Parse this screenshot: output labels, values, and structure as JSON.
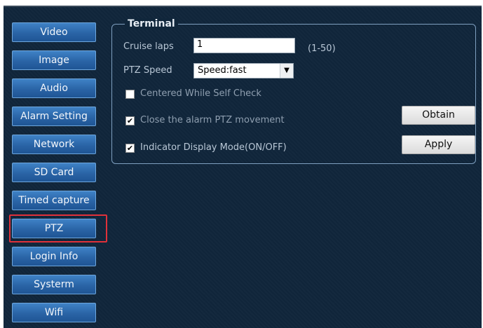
{
  "menu": {
    "items": [
      {
        "label": "Video"
      },
      {
        "label": "Image"
      },
      {
        "label": "Audio"
      },
      {
        "label": "Alarm Setting"
      },
      {
        "label": "Network"
      },
      {
        "label": "SD Card"
      },
      {
        "label": "Timed capture"
      },
      {
        "label": "PTZ"
      },
      {
        "label": "Login Info"
      },
      {
        "label": "Systerm"
      },
      {
        "label": "Wifi"
      }
    ],
    "selected": "PTZ"
  },
  "terminal": {
    "title": "Terminal",
    "cruise_laps_label": "Cruise laps",
    "cruise_laps_value": "1",
    "cruise_laps_range": "(1-50)",
    "ptz_speed_label": "PTZ Speed",
    "ptz_speed_value": "Speed:fast",
    "centered_label": "Centered While Self Check",
    "centered_checked": false,
    "close_alarm_label": "Close the alarm PTZ movement",
    "close_alarm_checked": true,
    "indicator_label": "Indicator Display Mode(ON/OFF)",
    "indicator_checked": true,
    "obtain_label": "Obtain",
    "apply_label": "Apply"
  },
  "colors": {
    "background": "#10263b",
    "menu_button": "#2a64a6",
    "selected_outline": "#e0313a"
  }
}
